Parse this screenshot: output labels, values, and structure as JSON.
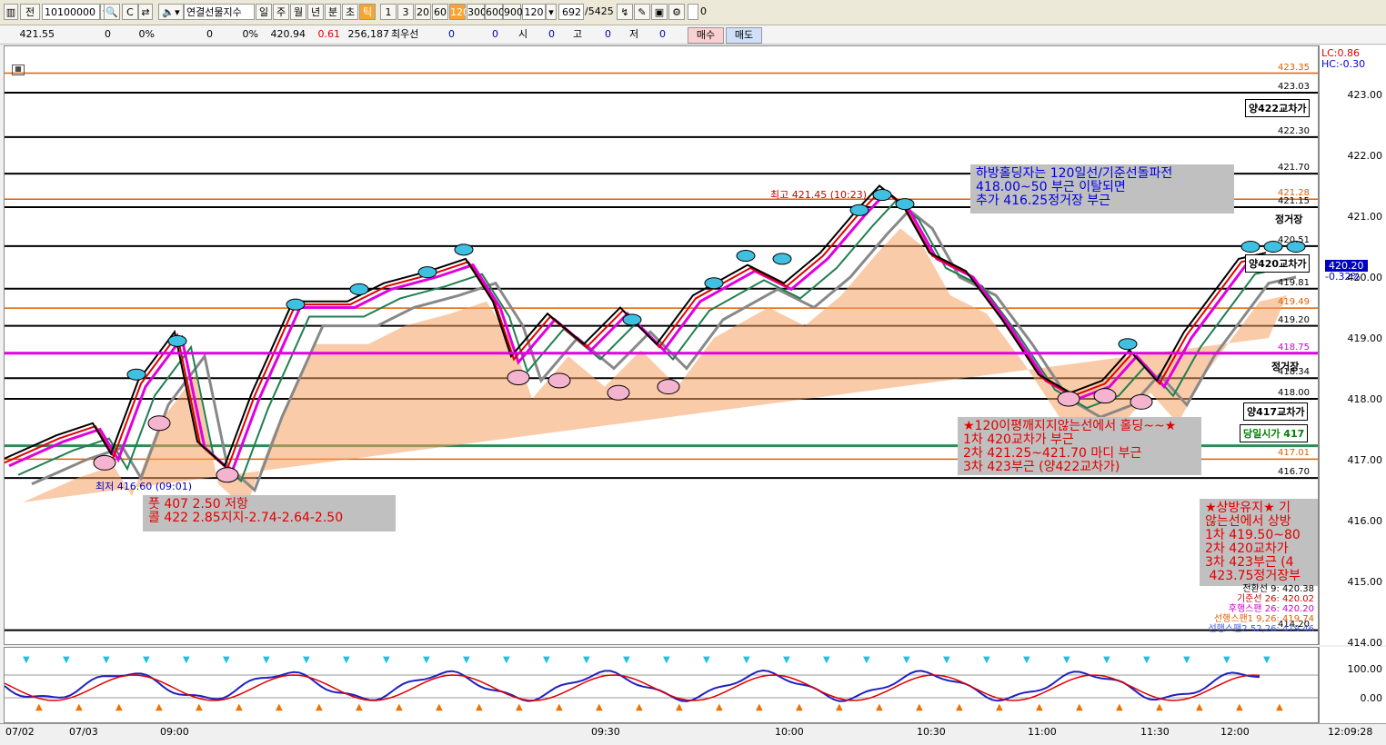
{
  "toolbar": {
    "code": "10100000",
    "name": "연결선물지수",
    "period_tabs": [
      "일",
      "주",
      "월",
      "년",
      "분",
      "초",
      "틱"
    ],
    "intervals": [
      "1",
      "3",
      "20",
      "60",
      "120",
      "300",
      "600",
      "900"
    ],
    "selected_interval": "120",
    "interval_select": "120",
    "count": "692",
    "total": "/5425",
    "prefix_btn": "전",
    "checkbox_label": "0"
  },
  "infobar": {
    "v1": "421.55",
    "v2": "0",
    "v3": "0%",
    "v4": "0",
    "v5": "0%",
    "v6": "420.94",
    "v7": "0.61",
    "v8": "256,187",
    "l1": "최우선",
    "v9": "0",
    "v10": "0",
    "l2": "시",
    "v11": "0",
    "l3": "고",
    "v12": "0",
    "l4": "저",
    "v13": "0",
    "buy": "매수",
    "sell": "매도"
  },
  "axis": {
    "lc": "LC:0.86",
    "hc": "HC:-0.30",
    "current": "420.20",
    "change": "-0.32%",
    "ticks": [
      "423.00",
      "422.00",
      "421.00",
      "420.00",
      "419.00",
      "418.00",
      "417.00",
      "416.00",
      "415.00",
      "414.00"
    ],
    "osc_ticks": [
      "100.00",
      "0.00"
    ],
    "time": "12:09:28"
  },
  "time_labels": [
    "07/02",
    "07/03",
    "09:00",
    "09:30",
    "10:00",
    "10:30",
    "11:00",
    "11:30",
    "12:00"
  ],
  "levels": [
    {
      "label": "423.35",
      "color": "#e06000"
    },
    {
      "label": "423.03",
      "color": "#000000"
    },
    {
      "label": "422.30",
      "color": "#000000"
    },
    {
      "label": "421.70",
      "color": "#000000"
    },
    {
      "label": "421.28",
      "color": "#e06000"
    },
    {
      "label": "421.15",
      "color": "#000000"
    },
    {
      "label": "420.51",
      "color": "#000000"
    },
    {
      "label": "419.81",
      "color": "#000000"
    },
    {
      "label": "419.49",
      "color": "#e06000"
    },
    {
      "label": "419.20",
      "color": "#000000"
    },
    {
      "label": "418.75",
      "color": "#cc00cc"
    },
    {
      "label": "418.34",
      "color": "#000000"
    },
    {
      "label": "418.00",
      "color": "#000000"
    },
    {
      "label": "417.01",
      "color": "#e06000"
    },
    {
      "label": "416.70",
      "color": "#000000"
    },
    {
      "label": "414.20",
      "color": "#000000"
    }
  ],
  "tags": {
    "t1": "양422교차가",
    "t2": "정거장",
    "t3": "양420교차가",
    "t4": "정거장",
    "t5": "양417교차가",
    "t6": "당일시가 417"
  },
  "labels": {
    "high": "최고 421.45 (10:23)",
    "low": "최저 416.60 (09:01)"
  },
  "notes": {
    "n1": "하방홀딩자는 120일선/기준선돌파전\n418.00~50 부근 이탈되면\n추가 416.25정거장 부근",
    "n2": "★120이평깨지지않는선에서 홀딩~~★\n1차 420교차가 부근\n2차 421.25~421.70 마디 부근\n3차 423부근 (양422교차가)",
    "n3": "풋 407 2.50 저항\n콜 422 2.85지지-2.74-2.64-2.50",
    "n4": "★상방유지★ 기\n않는선에서 상방\n1차 419.50~80\n2차 420교차가 \n3차 423부근 (4\n 423.75정거장부"
  },
  "legend": [
    {
      "text": "전환선 9: 420.38",
      "color": "#000000"
    },
    {
      "text": "기준선 26: 420.02",
      "color": "#cc0000"
    },
    {
      "text": "후행스팬 26: 420.20",
      "color": "#cc00cc"
    },
    {
      "text": "선행스팬1 9,26: 419.74",
      "color": "#e06000"
    },
    {
      "text": "선행스팬2 52,26: 419.46",
      "color": "#4060e0"
    }
  ],
  "colors": {
    "orange": "#e87000",
    "black": "#000000",
    "magenta": "#e000e0",
    "green": "#208050"
  }
}
